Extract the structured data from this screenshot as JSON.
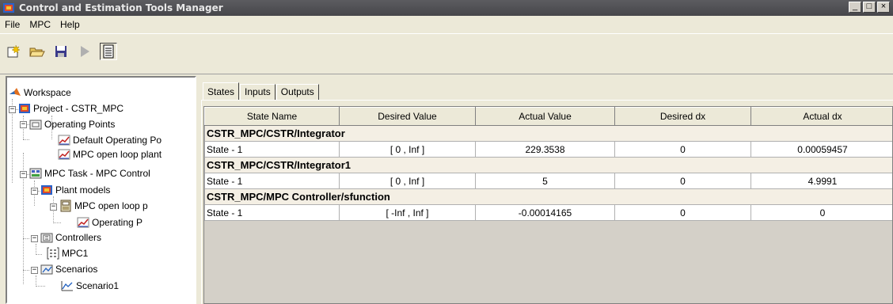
{
  "window": {
    "title": "Control and Estimation Tools Manager",
    "controls": {
      "minimize": "_",
      "maximize": "□",
      "close": "×"
    }
  },
  "menu": {
    "items": [
      "File",
      "MPC",
      "Help"
    ]
  },
  "toolbar": {
    "buttons": [
      {
        "icon": "new-task-icon"
      },
      {
        "icon": "open-folder-icon"
      },
      {
        "icon": "save-disk-icon"
      },
      {
        "icon": "play-icon"
      },
      {
        "icon": "document-icon"
      }
    ]
  },
  "tree": {
    "workspace": "Workspace",
    "project": "Project - CSTR_MPC",
    "operating_points": "Operating Points",
    "default_op": "Default Operating Po",
    "mpc_open_loop_plant": "MPC open loop plant",
    "mpc_task": "MPC Task - MPC Control",
    "plant_models": "Plant models",
    "mpc_open_loop_model": "MPC open loop p",
    "operating_p": "Operating P",
    "controllers": "Controllers",
    "mpc1": "MPC1",
    "scenarios": "Scenarios",
    "scenario1": "Scenario1"
  },
  "tabs": [
    "States",
    "Inputs",
    "Outputs"
  ],
  "table": {
    "headers": [
      "State Name",
      "Desired Value",
      "Actual Value",
      "Desired dx",
      "Actual dx"
    ],
    "groups": [
      {
        "name": "CSTR_MPC/CSTR/Integrator",
        "rows": [
          [
            "State - 1",
            "[ 0 , Inf ]",
            "229.3538",
            "0",
            "0.00059457"
          ]
        ]
      },
      {
        "name": "CSTR_MPC/CSTR/Integrator1",
        "rows": [
          [
            "State - 1",
            "[ 0 , Inf ]",
            "5",
            "0",
            "4.9991"
          ]
        ]
      },
      {
        "name": "CSTR_MPC/MPC Controller/sfunction",
        "rows": [
          [
            "State - 1",
            "[ -Inf , Inf ]",
            "-0.00014165",
            "0",
            "0"
          ]
        ]
      }
    ]
  }
}
